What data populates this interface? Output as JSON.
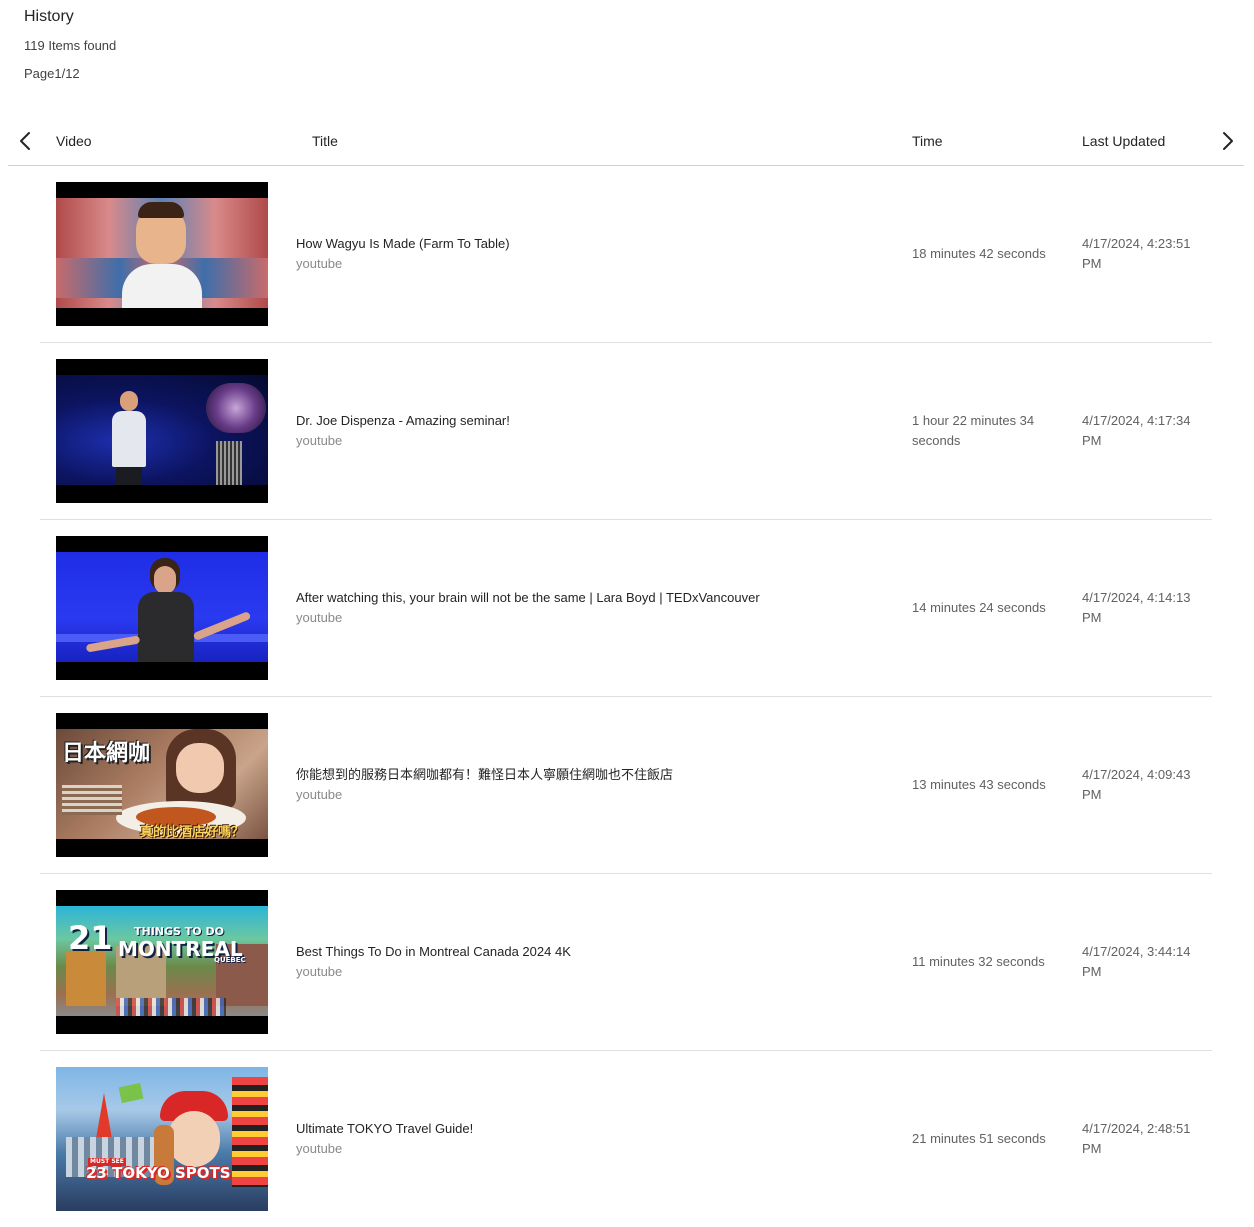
{
  "header": {
    "title": "History",
    "items_found": "119 Items found",
    "page": "Page1/12"
  },
  "columns": {
    "video": "Video",
    "title": "Title",
    "time": "Time",
    "last_updated": "Last Updated"
  },
  "icons": {
    "prev": "chevron-left-icon",
    "next": "chevron-right-icon"
  },
  "rows": [
    {
      "title": "How Wagyu Is Made (Farm To Table)",
      "source": "youtube",
      "time": "18 minutes 42 seconds",
      "updated": "4/17/2024, 4:23:51 PM"
    },
    {
      "title": "Dr. Joe Dispenza - Amazing seminar!",
      "source": "youtube",
      "time": "1 hour 22 minutes 34 seconds",
      "updated": "4/17/2024, 4:17:34 PM"
    },
    {
      "title": "After watching this, your brain will not be the same | Lara Boyd | TEDxVancouver",
      "source": "youtube",
      "time": "14 minutes 24 seconds",
      "updated": "4/17/2024, 4:14:13 PM"
    },
    {
      "title": "你能想到的服務日本網咖都有！難怪日本人寧願住網咖也不住飯店",
      "source": "youtube",
      "time": "13 minutes 43 seconds",
      "updated": "4/17/2024, 4:09:43 PM",
      "thumb_text": [
        "日本網咖",
        "真的比酒店好嗎？"
      ]
    },
    {
      "title": "Best Things To Do in Montreal Canada 2024 4K",
      "source": "youtube",
      "time": "11 minutes 32 seconds",
      "updated": "4/17/2024, 3:44:14 PM",
      "thumb_text": [
        "21",
        "THINGS TO DO",
        "MONTREAL",
        "QUEBEC"
      ]
    },
    {
      "title": "Ultimate TOKYO Travel Guide!",
      "source": "youtube",
      "time": "21 minutes 51 seconds",
      "updated": "4/17/2024, 2:48:51 PM",
      "thumb_text": [
        "MUST SEE",
        "23 TOKYO SPOTS"
      ]
    }
  ]
}
